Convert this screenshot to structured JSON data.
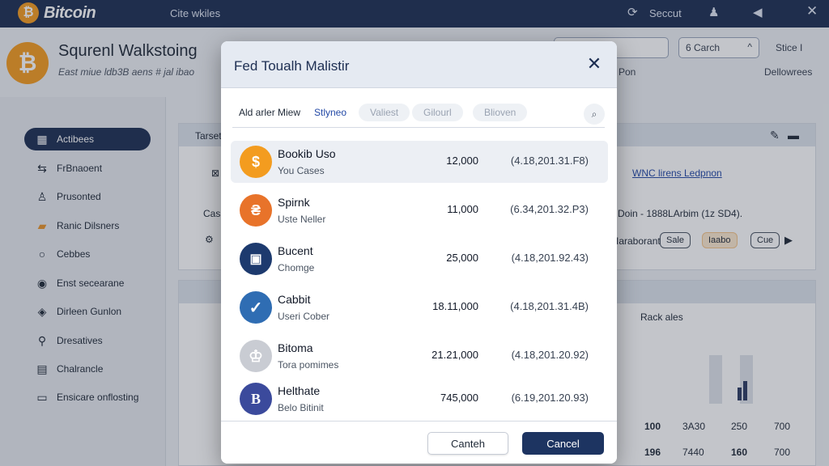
{
  "topbar": {
    "brand_symbol": "₿",
    "brand_name": "Bitcoin",
    "nav_label": "Cite wkiles",
    "secure_icon": "sync-icon",
    "secure_label": "Seccut",
    "user_icon": "user-icon",
    "bell_icon": "notification-icon",
    "close_icon": "close-icon"
  },
  "page": {
    "coin_symbol": "₿",
    "title": "Squrenl Walkstoing",
    "subtitle": "East miue ldb3B aens # jal ibao",
    "search_select_value": "6 Carch",
    "stice_link": "Stice I",
    "dellowrees_link": "Dellowrees",
    "pon_text": "Pon"
  },
  "sidebar": {
    "items": [
      {
        "label": "Actibees",
        "icon": "dashboard-icon",
        "active": true
      },
      {
        "label": "FrBnaoent",
        "icon": "transfer-icon",
        "active": false
      },
      {
        "label": "Prusonted",
        "icon": "user-icon",
        "active": false
      },
      {
        "label": "Ranic Dilsners",
        "icon": "folder-icon",
        "active": false
      },
      {
        "label": "Cebbes",
        "icon": "circle-icon",
        "active": false
      },
      {
        "label": "Enst secearane",
        "icon": "target-icon",
        "active": false
      },
      {
        "label": "Dirleen Gunlon",
        "icon": "chat-icon",
        "active": false
      },
      {
        "label": "Dresatives",
        "icon": "location-icon",
        "active": false
      },
      {
        "label": "Chalrancle",
        "icon": "table-icon",
        "active": false
      },
      {
        "label": "Ensicare onflosting",
        "icon": "monitor-icon",
        "active": false
      }
    ]
  },
  "background": {
    "panel1_head": "Tarset",
    "panel_link": "WNC lirens Ledpnon",
    "side_label": "Cas",
    "desc_text": "Doin - 1888LArbim (1z SD4).",
    "action_label": "Iaraborant",
    "pill_sale": "Sale",
    "pill_orange": "Iaabo",
    "pill_cue": "Cue",
    "rack_label": "Rack ales",
    "table_rows": [
      [
        "100",
        "3A30",
        "250",
        "700"
      ],
      [
        "196",
        "7440",
        "160",
        "700"
      ]
    ]
  },
  "modal": {
    "title": "Fed Toualh Malistir",
    "close_label": "✕",
    "tabs": {
      "label": "Ald arler Miew",
      "link": "Stlyneo",
      "ghost1": "Valiest",
      "ghost2": "Gilourl",
      "ghost3": "Blioven"
    },
    "search_icon": "search-icon",
    "rows": [
      {
        "name": "Bookib Uso",
        "sub": "You Cases",
        "amount": "12,000",
        "date": "(4.18,201.31.F8)",
        "icon_glyph": "$",
        "color": "#f39c1f",
        "selected": true
      },
      {
        "name": "Spirnk",
        "sub": "Uste Neller",
        "amount": "11,000",
        "date": "(6.34,201.32.P3)",
        "icon_glyph": "₴",
        "color": "#e8732a",
        "selected": false
      },
      {
        "name": "Bucent",
        "sub": "Chomge",
        "amount": "25,000",
        "date": "(4.18,201.92.43)",
        "icon_glyph": "▣",
        "color": "#1d3a6e",
        "selected": false
      },
      {
        "name": "Cabbit",
        "sub": "Useri Cober",
        "amount": "18.11,000",
        "date": "(4.18,201.31.4B)",
        "icon_glyph": "✓",
        "color": "#2f6db3",
        "selected": false
      },
      {
        "name": "Bitoma",
        "sub": "Tora pomimes",
        "amount": "21.21,000",
        "date": "(4.18,201.20.92)",
        "icon_glyph": "♔",
        "color": "#c9ccd3",
        "selected": false
      },
      {
        "name": "Helthate",
        "sub": "Belo Bitinit",
        "amount": "745,000",
        "date": "(6.19,201.20.93)",
        "icon_glyph": "B",
        "color": "#3b4a9c",
        "selected": false
      }
    ],
    "footer": {
      "secondary_label": "Canteh",
      "primary_label": "Cancel"
    }
  }
}
